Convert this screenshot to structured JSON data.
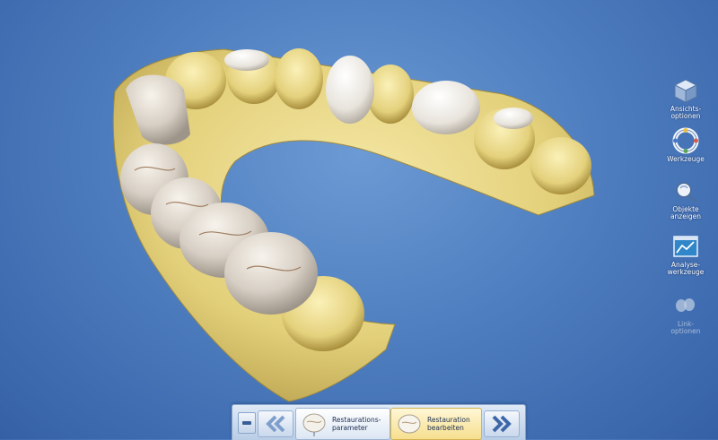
{
  "toolbar": {
    "items": [
      {
        "label": "Ansichts-\noptionen",
        "icon": "cube-icon"
      },
      {
        "label": "Werkzeuge",
        "icon": "tool-ring-icon"
      },
      {
        "label": "Objekte\nanzeigen",
        "icon": "object-magnifier-icon"
      },
      {
        "label": "Analyse-\nwerkzeuge",
        "icon": "analysis-window-icon"
      },
      {
        "label": "Link-\noptionen",
        "icon": "link-teeth-icon",
        "disabled": true
      }
    ]
  },
  "workflow": {
    "steps": [
      {
        "label": "Restaurations-\nparameter",
        "icon": "tooth-parameters-icon"
      },
      {
        "label": "Restauration\nbearbeiten",
        "icon": "tooth-edit-icon",
        "active": true
      }
    ]
  },
  "colors": {
    "background": "#4f7fc0",
    "gingiva_model": "#e6d684",
    "restoration": "#d9d2c8",
    "accent_active_step": "#f6df8e"
  }
}
